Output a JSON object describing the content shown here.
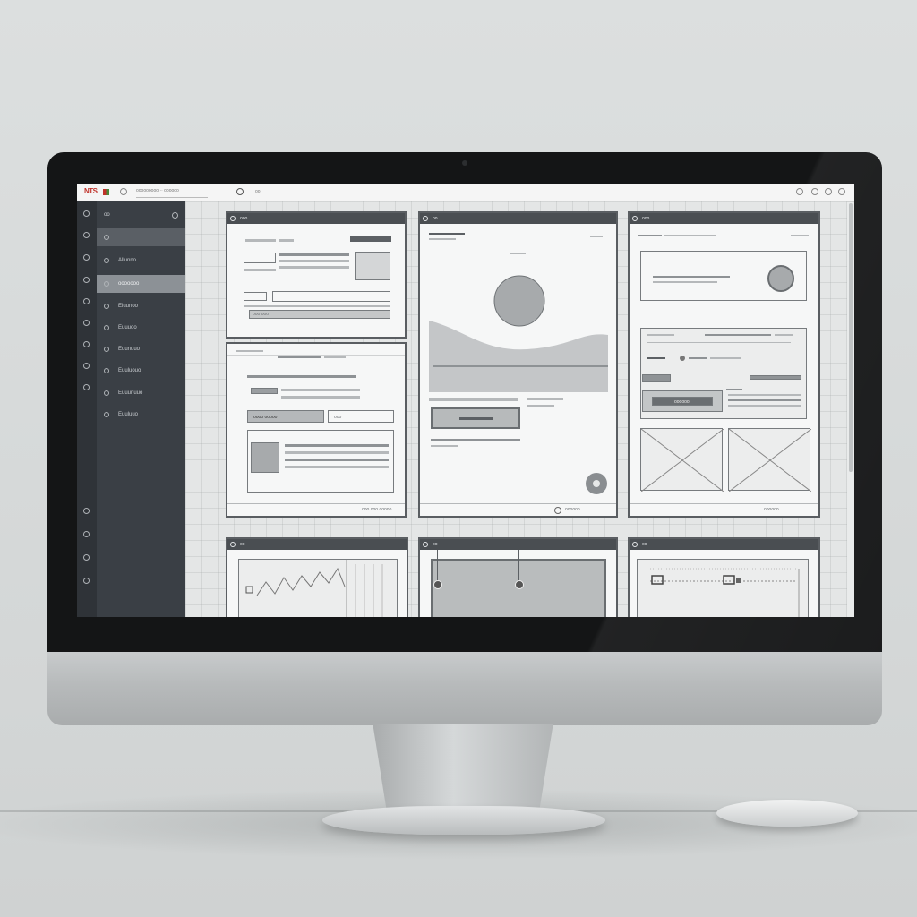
{
  "app": {
    "logo": "NTS",
    "search_text": "ooooooooo ·· oooooo",
    "toolbar_text": "oo",
    "window_controls": [
      "circle",
      "circle",
      "circle",
      "circle"
    ]
  },
  "sidebar": {
    "top_label": "oo",
    "items": [
      {
        "label": "",
        "state": "active"
      },
      {
        "label": "Allunno",
        "state": "normal"
      },
      {
        "label": "ooooooo",
        "state": "selected"
      },
      {
        "label": "Eluunoo",
        "state": "normal"
      },
      {
        "label": "Euuuoo",
        "state": "normal"
      },
      {
        "label": "Euunuuo",
        "state": "normal"
      },
      {
        "label": "Euuluouo",
        "state": "normal"
      },
      {
        "label": "Euuunuuo",
        "state": "normal"
      },
      {
        "label": "Euuluuo",
        "state": "normal"
      }
    ]
  },
  "panels": [
    {
      "title": "ooo"
    },
    {
      "title": "oo"
    },
    {
      "title": "ooo"
    },
    {
      "title": ""
    },
    {
      "title": "oo"
    },
    {
      "title": "oo"
    },
    {
      "title": "oo"
    }
  ],
  "panel_texts": {
    "p1_footer": "ooo ooo",
    "p2_footer": "oooo ooooo",
    "p3_footer": "ooo",
    "p4_button": "ooooo",
    "p4_footer": "ooo ooo ooooo",
    "p5_button": "oooooo",
    "p5_button2": "oooooo",
    "p6_footer": "oooooo"
  },
  "colors": {
    "bezel": "#141516",
    "sidebar": "#3a3f45",
    "panel_header": "#4a4e52",
    "logo_red": "#c0332b"
  }
}
